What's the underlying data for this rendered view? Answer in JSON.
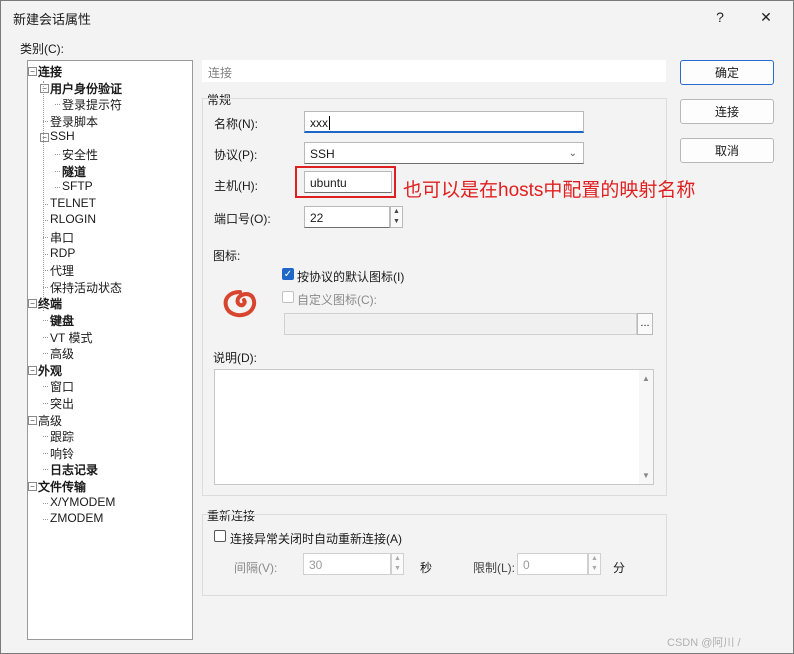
{
  "window": {
    "title": "新建会话属性",
    "help": "?",
    "close": "✕"
  },
  "category_label": "类别(C):",
  "tree": [
    {
      "label": "连接",
      "bold": true,
      "level": 0
    },
    {
      "label": "用户身份验证",
      "bold": true,
      "level": 1
    },
    {
      "label": "登录提示符",
      "bold": false,
      "level": 2
    },
    {
      "label": "登录脚本",
      "bold": false,
      "level": 1
    },
    {
      "label": "SSH",
      "bold": false,
      "level": 1
    },
    {
      "label": "安全性",
      "bold": false,
      "level": 2
    },
    {
      "label": "隧道",
      "bold": true,
      "level": 2
    },
    {
      "label": "SFTP",
      "bold": false,
      "level": 2
    },
    {
      "label": "TELNET",
      "bold": false,
      "level": 1
    },
    {
      "label": "RLOGIN",
      "bold": false,
      "level": 1
    },
    {
      "label": "串口",
      "bold": false,
      "level": 1
    },
    {
      "label": "RDP",
      "bold": false,
      "level": 1
    },
    {
      "label": "代理",
      "bold": false,
      "level": 1
    },
    {
      "label": "保持活动状态",
      "bold": false,
      "level": 1
    },
    {
      "label": "终端",
      "bold": true,
      "level": 0
    },
    {
      "label": "键盘",
      "bold": true,
      "level": 1
    },
    {
      "label": "VT 模式",
      "bold": false,
      "level": 1
    },
    {
      "label": "高级",
      "bold": false,
      "level": 1
    },
    {
      "label": "外观",
      "bold": true,
      "level": 0
    },
    {
      "label": "窗口",
      "bold": false,
      "level": 1
    },
    {
      "label": "突出",
      "bold": false,
      "level": 1
    },
    {
      "label": "高级",
      "bold": false,
      "level": 0
    },
    {
      "label": "跟踪",
      "bold": false,
      "level": 1
    },
    {
      "label": "响铃",
      "bold": false,
      "level": 1
    },
    {
      "label": "日志记录",
      "bold": true,
      "level": 1
    },
    {
      "label": "文件传输",
      "bold": true,
      "level": 0
    },
    {
      "label": "X/YMODEM",
      "bold": false,
      "level": 1
    },
    {
      "label": "ZMODEM",
      "bold": false,
      "level": 1
    }
  ],
  "panel": {
    "header": "连接",
    "general_group": "常规",
    "name_label": "名称(N):",
    "name_value": "xxx",
    "protocol_label": "协议(P):",
    "protocol_value": "SSH",
    "host_label": "主机(H):",
    "host_value": "ubuntu",
    "port_label": "端口号(O):",
    "port_value": "22",
    "icon_label": "图标:",
    "default_icon_check": "按协议的默认图标(I)",
    "custom_icon_check": "自定义图标(C):",
    "browse": "...",
    "desc_label": "说明(D):",
    "reconnect_group": "重新连接",
    "reconnect_check": "连接异常关闭时自动重新连接(A)",
    "interval_label": "间隔(V):",
    "interval_value": "30",
    "interval_unit": "秒",
    "limit_label": "限制(L):",
    "limit_value": "0",
    "limit_unit": "分"
  },
  "buttons": {
    "ok": "确定",
    "connect": "连接",
    "cancel": "取消"
  },
  "annotation": "也可以是在hosts中配置的映射名称",
  "watermark": "CSDN @阿川 /",
  "colors": {
    "accent": "#1f66c9",
    "annotation_red": "#e02020"
  }
}
